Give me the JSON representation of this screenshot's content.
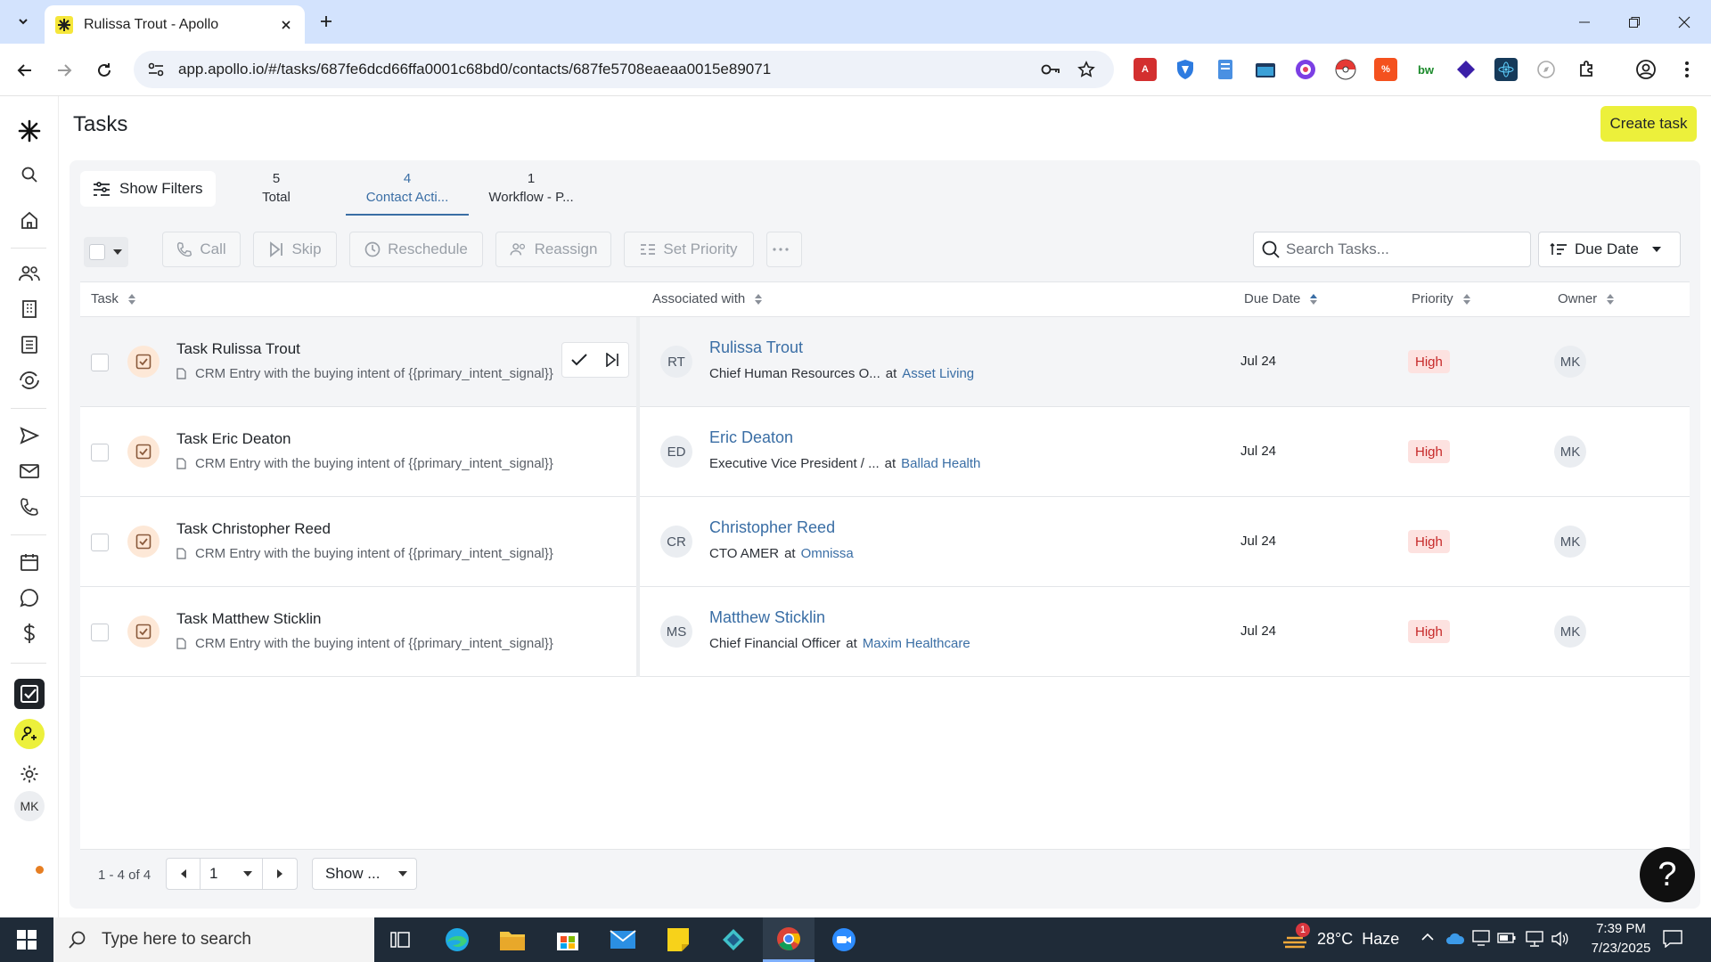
{
  "browser": {
    "tab_title": "Rulissa Trout - Apollo",
    "url": "app.apollo.io/#/tasks/687fe6dcd66ffa0001c68bd0/contacts/687fe5708eaeaa0015e89071"
  },
  "page": {
    "title": "Tasks",
    "create_label": "Create task"
  },
  "filters": {
    "show_filters_label": "Show Filters",
    "tabs": [
      {
        "count": "5",
        "label": "Total"
      },
      {
        "count": "4",
        "label": "Contact Acti..."
      },
      {
        "count": "1",
        "label": "Workflow - P..."
      }
    ]
  },
  "actions": {
    "call": "Call",
    "skip": "Skip",
    "reschedule": "Reschedule",
    "reassign": "Reassign",
    "set_priority": "Set Priority",
    "search_placeholder": "Search Tasks...",
    "sort_label": "Due Date"
  },
  "table": {
    "headers": {
      "task": "Task",
      "associated": "Associated with",
      "due": "Due Date",
      "priority": "Priority",
      "owner": "Owner"
    },
    "rows": [
      {
        "task": "Task Rulissa Trout",
        "note": "CRM Entry with the buying intent of {{primary_intent_signal}}",
        "initials": "RT",
        "contact": "Rulissa Trout",
        "title": "Chief Human Resources O...",
        "at": "at",
        "company": "Asset Living",
        "due": "Jul 24",
        "priority": "High",
        "owner": "MK"
      },
      {
        "task": "Task Eric Deaton",
        "note": "CRM Entry with the buying intent of {{primary_intent_signal}}",
        "initials": "ED",
        "contact": "Eric Deaton",
        "title": "Executive Vice President / ...",
        "at": "at",
        "company": "Ballad Health",
        "due": "Jul 24",
        "priority": "High",
        "owner": "MK"
      },
      {
        "task": "Task Christopher Reed",
        "note": "CRM Entry with the buying intent of {{primary_intent_signal}}",
        "initials": "CR",
        "contact": "Christopher Reed",
        "title": "CTO AMER",
        "at": "at",
        "company": "Omnissa",
        "due": "Jul 24",
        "priority": "High",
        "owner": "MK"
      },
      {
        "task": "Task Matthew Sticklin",
        "note": "CRM Entry with the buying intent of {{primary_intent_signal}}",
        "initials": "MS",
        "contact": "Matthew Sticklin",
        "title": "Chief Financial Officer",
        "at": "at",
        "company": "Maxim Healthcare",
        "due": "Jul 24",
        "priority": "High",
        "owner": "MK"
      }
    ]
  },
  "pagination": {
    "range": "1 - 4 of 4",
    "page": "1",
    "show_label": "Show ..."
  },
  "help": {
    "label": "?"
  },
  "sidebar": {
    "user_initials": "MK"
  },
  "taskbar": {
    "search_placeholder": "Type here to search",
    "weather": "28°C  Haze",
    "weather_badge": "1",
    "time": "7:39 PM",
    "date": "7/23/2025"
  },
  "colors": {
    "accent": "#3a6ea5",
    "create_button": "#ecf03b",
    "priority_high_bg": "#fde2e0",
    "priority_high_text": "#c62828",
    "task_icon_bg": "#fde8d7"
  }
}
